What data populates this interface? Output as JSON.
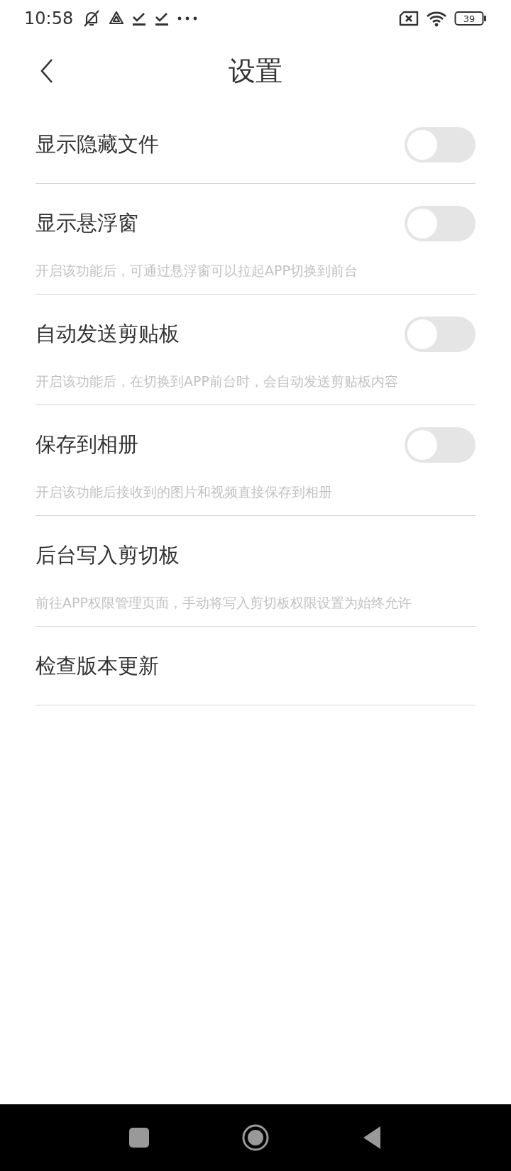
{
  "status_bar": {
    "time": "10:58",
    "battery": "39"
  },
  "header": {
    "title": "设置"
  },
  "settings": [
    {
      "kind": "toggle",
      "label": "显示隐藏文件",
      "on": false
    },
    {
      "kind": "toggle",
      "label": "显示悬浮窗",
      "on": false,
      "description": "开启该功能后，可通过悬浮窗可以拉起APP切换到前台"
    },
    {
      "kind": "toggle",
      "label": "自动发送剪贴板",
      "on": false,
      "description": "开启该功能后，在切换到APP前台时，会自动发送剪贴板内容"
    },
    {
      "kind": "toggle",
      "label": "保存到相册",
      "on": false,
      "description": "开启该功能后接收到的图片和视频直接保存到相册"
    },
    {
      "kind": "link",
      "label": "后台写入剪切板",
      "description": "前往APP权限管理页面，手动将写入剪切板权限设置为始终允许"
    },
    {
      "kind": "link",
      "label": "检查版本更新"
    }
  ]
}
